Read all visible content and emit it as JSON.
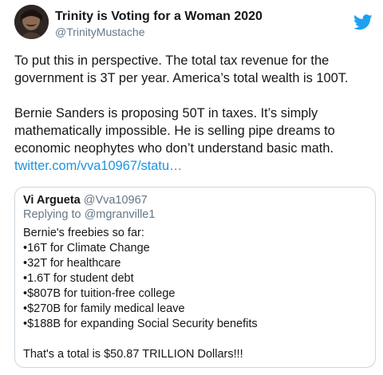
{
  "author": {
    "display_name": "Trinity is Voting for a Woman 2020",
    "handle": "@TrinityMustache"
  },
  "icons": {
    "avatar": "profile-photo",
    "platform": "twitter-bird-icon",
    "bird_color": "#1da1f2"
  },
  "tweet": {
    "paragraph1": "To put this in perspective. The total tax revenue for the government is 3T per year. America’s total wealth is 100T.",
    "paragraph2": "Bernie Sanders is proposing 50T in taxes. It’s simply mathematically impossible. He is selling pipe dreams to economic neophytes who don’t understand basic math.",
    "link": "twitter.com/vva10967/statu…"
  },
  "quoted": {
    "display_name": "Vi Argueta",
    "handle": "@Vva10967",
    "replying_to": "Replying to @mgranville1",
    "intro": "Bernie's freebies so far:",
    "items": [
      "•16T for Climate Change",
      "•32T for healthcare",
      "•1.6T for student debt",
      "•$807B for tuition-free college",
      "•$270B for family medical leave",
      "•$188B for expanding Social Security benefits"
    ],
    "total": "That's a total is $50.87 TRILLION Dollars!!!"
  },
  "colors": {
    "link": "#1b95e0",
    "secondary_text": "#657786",
    "border": "#ccd6dd"
  }
}
